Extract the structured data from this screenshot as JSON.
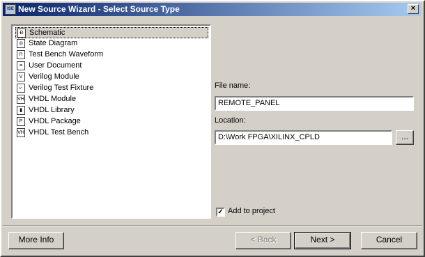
{
  "window": {
    "title": "New Source Wizard - Select Source Type",
    "icon": "ise-app-icon",
    "close_label": "×"
  },
  "source_types": [
    {
      "label": "Schematic",
      "icon": "schematic-icon",
      "glyph": "Đ",
      "selected": true
    },
    {
      "label": "State Diagram",
      "icon": "state-diagram-icon",
      "glyph": "◎",
      "selected": false
    },
    {
      "label": "Test Bench Waveform",
      "icon": "waveform-icon",
      "glyph": "⊓",
      "selected": false
    },
    {
      "label": "User Document",
      "icon": "document-icon",
      "glyph": "≡",
      "selected": false
    },
    {
      "label": "Verilog Module",
      "icon": "verilog-module-icon",
      "glyph": "V",
      "selected": false
    },
    {
      "label": "Verilog Test Fixture",
      "icon": "verilog-fixture-icon",
      "glyph": "⩗",
      "selected": false
    },
    {
      "label": "VHDL Module",
      "icon": "vhdl-module-icon",
      "glyph": "VH",
      "selected": false
    },
    {
      "label": "VHDL Library",
      "icon": "vhdl-library-icon",
      "glyph": "▮",
      "selected": false
    },
    {
      "label": "VHDL Package",
      "icon": "vhdl-package-icon",
      "glyph": "P",
      "selected": false
    },
    {
      "label": "VHDL Test Bench",
      "icon": "vhdl-testbench-icon",
      "glyph": "VH",
      "selected": false
    }
  ],
  "file_name": {
    "label": "File name:",
    "value": "REMOTE_PANEL"
  },
  "location": {
    "label": "Location:",
    "value": "D:\\Work FPGA\\XILINX_CPLD",
    "browse_label": "..."
  },
  "add_to_project": {
    "label": "Add to project",
    "checked": true,
    "check_glyph": "✓"
  },
  "buttons": {
    "more_info": "More Info",
    "back": "< Back",
    "next": "Next >",
    "cancel": "Cancel"
  }
}
